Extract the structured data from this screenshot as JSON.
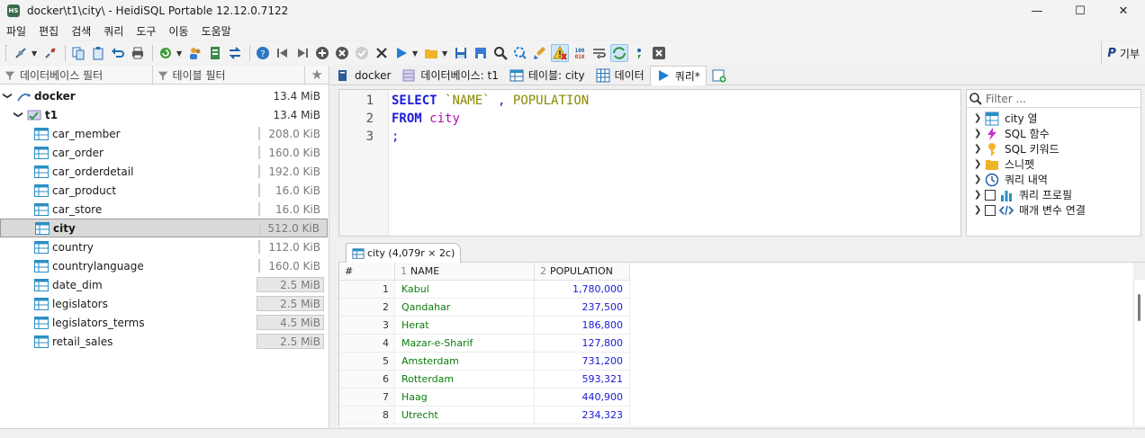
{
  "window": {
    "title": "docker\\t1\\city\\ - HeidiSQL Portable 12.12.0.7122",
    "logo": "HS",
    "minimize": "—",
    "maximize": "☐",
    "close": "✕"
  },
  "menu": [
    "파일",
    "편집",
    "검색",
    "쿼리",
    "도구",
    "이동",
    "도움말"
  ],
  "toolbar": {
    "donate_brand": "P",
    "donate_label": "기부"
  },
  "left": {
    "db_filter_placeholder": "데이터베이스 필터",
    "table_filter_placeholder": "테이블 필터",
    "tree": {
      "server": {
        "label": "docker",
        "size": "13.4 MiB"
      },
      "database": {
        "label": "t1",
        "size": "13.4 MiB"
      },
      "tables": [
        {
          "label": "car_member",
          "size": "208.0 KiB",
          "fill": 0.0
        },
        {
          "label": "car_order",
          "size": "160.0 KiB",
          "fill": 0.0
        },
        {
          "label": "car_orderdetail",
          "size": "192.0 KiB",
          "fill": 0.0
        },
        {
          "label": "car_product",
          "size": "16.0 KiB",
          "fill": 0.0
        },
        {
          "label": "car_store",
          "size": "16.0 KiB",
          "fill": 0.0
        },
        {
          "label": "city",
          "size": "512.0 KiB",
          "fill": 0.0,
          "selected": true
        },
        {
          "label": "country",
          "size": "112.0 KiB",
          "fill": 0.0
        },
        {
          "label": "countrylanguage",
          "size": "160.0 KiB",
          "fill": 0.0
        },
        {
          "label": "date_dim",
          "size": "2.5 MiB",
          "fill": 1.0
        },
        {
          "label": "legislators",
          "size": "2.5 MiB",
          "fill": 1.0
        },
        {
          "label": "legislators_terms",
          "size": "4.5 MiB",
          "fill": 1.0
        },
        {
          "label": "retail_sales",
          "size": "2.5 MiB",
          "fill": 1.0
        }
      ]
    }
  },
  "tabs": [
    {
      "label": "docker",
      "icon": "server-icon"
    },
    {
      "label": "데이터베이스: t1",
      "icon": "database-icon"
    },
    {
      "label": "테이블: city",
      "icon": "table-icon"
    },
    {
      "label": "데이터",
      "icon": "grid-icon"
    },
    {
      "label": "쿼리*",
      "icon": "play-icon",
      "active": true
    }
  ],
  "editor": {
    "lines": [
      "1",
      "2",
      "3"
    ],
    "sql": {
      "select_kw": "SELECT",
      "col1": "`NAME`",
      "comma": " , ",
      "col2": "POPULATION",
      "from_kw": "FROM",
      "table": "city",
      "semicolon": ";"
    }
  },
  "helper": {
    "filter_placeholder": "Filter ...",
    "items": [
      {
        "label": "city 열",
        "icon": "table-columns-icon"
      },
      {
        "label": "SQL 함수",
        "icon": "lightning-icon"
      },
      {
        "label": "SQL 키워드",
        "icon": "key-icon"
      },
      {
        "label": "스니펫",
        "icon": "folder-icon"
      },
      {
        "label": "쿼리 내역",
        "icon": "clock-icon"
      },
      {
        "label": "쿼리 프로필",
        "icon": "bar-chart-icon",
        "checkbox": true
      },
      {
        "label": "매개 변수 연결",
        "icon": "code-icon",
        "checkbox": true
      }
    ]
  },
  "results": {
    "tab_label": "city (4,079r × 2c)",
    "columns": [
      {
        "num": "#",
        "name": ""
      },
      {
        "num": "1",
        "name": "NAME"
      },
      {
        "num": "2",
        "name": "POPULATION"
      }
    ],
    "rows": [
      {
        "n": "1",
        "name": "Kabul",
        "population": "1,780,000"
      },
      {
        "n": "2",
        "name": "Qandahar",
        "population": "237,500"
      },
      {
        "n": "3",
        "name": "Herat",
        "population": "186,800"
      },
      {
        "n": "4",
        "name": "Mazar-e-Sharif",
        "population": "127,800"
      },
      {
        "n": "5",
        "name": "Amsterdam",
        "population": "731,200"
      },
      {
        "n": "6",
        "name": "Rotterdam",
        "population": "593,321"
      },
      {
        "n": "7",
        "name": "Haag",
        "population": "440,900"
      },
      {
        "n": "8",
        "name": "Utrecht",
        "population": "234,323"
      }
    ]
  },
  "colors": {
    "accent": "#1a1ad8",
    "sql_ident": "#8a8a00",
    "sql_table": "#b40fb4",
    "cell_text": "#0a7d0a"
  }
}
